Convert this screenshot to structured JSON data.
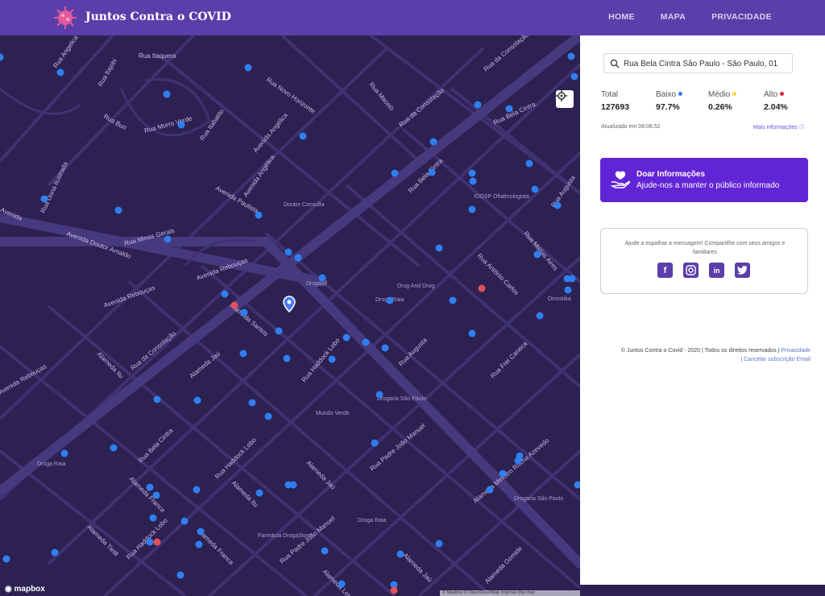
{
  "header": {
    "brand": "Juntos Contra o COVID",
    "nav": [
      "HOME",
      "MAPA",
      "PRIVACIDADE"
    ],
    "accent": "#5b3ea9"
  },
  "map": {
    "streets": [
      "Rua Angelica",
      "Rua Itajobi",
      "Rua Itaquera",
      "Rua Novo Horizonte",
      "Rua Maceió",
      "Rua da Consolação",
      "Avenida Angélica",
      "Rua Buri",
      "Rua Morro Verde",
      "Rua Itabatito",
      "Rua Bela Cintra",
      "Rua Dona Ilustrada",
      "Avenida Paulista",
      "Rua Augusta",
      "Rua Minas Gerais",
      "Avenida Doutor Arnaldo",
      "Avenida Rebouças",
      "Rua Matias Aires",
      "Rua Antônio Carlos",
      "Rua Frei Caneca",
      "Rua da Consolação",
      "Rua Haddock Lobo",
      "Alameda Itu",
      "Alameda Jaú",
      "Rua Padre João Manuel",
      "Alameda Franca",
      "Alameda Tietê",
      "Alameda Santos",
      "Alameda Ministro Rocha Azevedo",
      "Alameda Lorena"
    ],
    "pois": [
      "Doutor Consulta",
      "IOOSP Oftalmologista",
      "Drogasil",
      "Drug And Drug",
      "Droga Raia",
      "Drogaria São Paulo",
      "Mundo Verde",
      "Droga Raia",
      "Farmácia DrogaStore",
      "Drogaria São Paulo",
      "Drogasil",
      "Dinostika"
    ],
    "low_color": "#2f7ff0",
    "high_color": "#e0515c",
    "logo_text": "mapbox",
    "attribution": "© Mapbox © OpenStreetMap  Improve this map"
  },
  "panel": {
    "search_value": "Rua Bela Cintra São Paulo - São Paulo, 01",
    "stats": [
      {
        "label": "Total",
        "value": "127693",
        "color": ""
      },
      {
        "label": "Baixo",
        "value": "97.7%",
        "color": "#2f7ff0"
      },
      {
        "label": "Médio",
        "value": "0.26%",
        "color": "#f4d83a"
      },
      {
        "label": "Alto",
        "value": "2.04%",
        "color": "#e0203a"
      }
    ],
    "updated": "Atualizado em 08:06:52",
    "more_info": "Mais informações",
    "donate_title": "Doar Informações",
    "donate_subtitle": "Ajude-nos a manter o público informado",
    "share_text": "Ajude a espalhar a mensagem! Compartilhe com seus amigos e familiares",
    "social": [
      "f",
      "ig",
      "in",
      "tw"
    ],
    "footer_text": "© Juntos Contra o Covid - 2020 | Todos os direitos reservados |",
    "footer_privacy": "Privacidade",
    "footer_cancel": "| Cancelar subscrição Email"
  }
}
